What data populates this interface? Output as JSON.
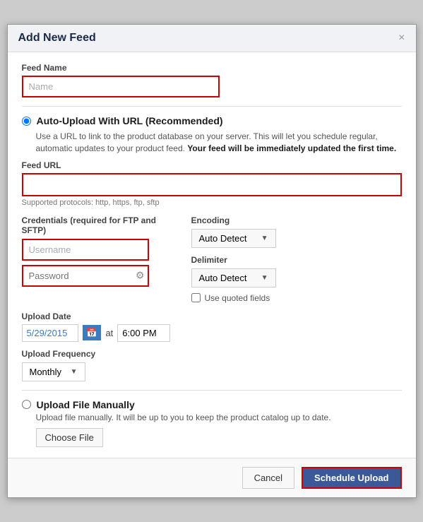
{
  "modal": {
    "title": "Add New Feed",
    "close_label": "×"
  },
  "feed_name": {
    "label": "Feed Name",
    "placeholder": "Name",
    "value": ""
  },
  "auto_upload": {
    "label": "Auto-Upload With URL (Recommended)",
    "description_part1": "Use a URL to link to the product database on your server. This will let you schedule regular, automatic updates to your product feed.",
    "description_bold": "Your feed will be immediately updated the first time.",
    "feed_url_label": "Feed URL",
    "feed_url_placeholder": "",
    "supported_protocols": "Supported protocols: http, https, ftp, sftp",
    "credentials_label": "Credentials (required for FTP and SFTP)",
    "username_placeholder": "Username",
    "password_placeholder": "Password",
    "encoding_label": "Encoding",
    "encoding_value": "Auto Detect",
    "delimiter_label": "Delimiter",
    "delimiter_value": "Auto Detect",
    "use_quoted_fields_label": "Use quoted fields",
    "upload_date_label": "Upload Date",
    "upload_date_value": "5/29/2015",
    "at_label": "at",
    "upload_time_value": "6:00 PM",
    "upload_frequency_label": "Upload Frequency",
    "frequency_value": "Monthly"
  },
  "manual_upload": {
    "label": "Upload File Manually",
    "description": "Upload file manually. It will be up to you to keep the product catalog up to date.",
    "choose_file_label": "Choose File"
  },
  "footer": {
    "cancel_label": "Cancel",
    "schedule_label": "Schedule Upload"
  }
}
